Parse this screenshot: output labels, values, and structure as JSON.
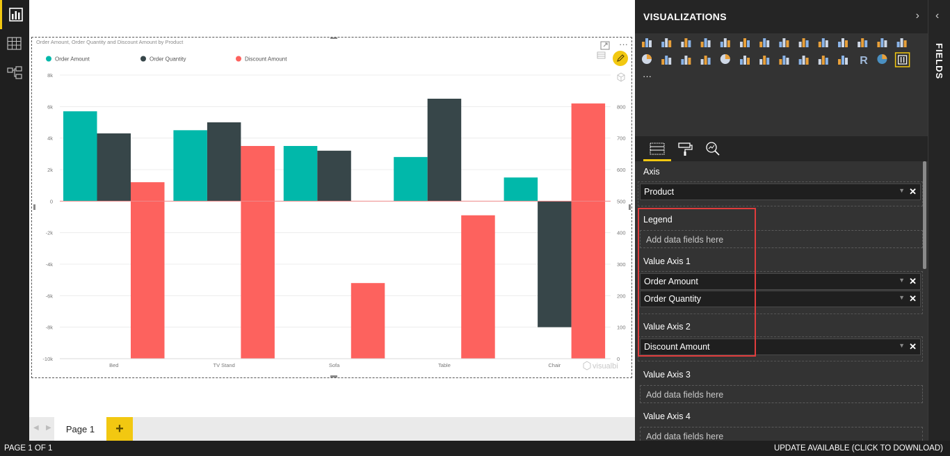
{
  "status_bar": {
    "page_indicator": "PAGE 1 OF 1",
    "update_notice": "UPDATE AVAILABLE (CLICK TO DOWNLOAD)"
  },
  "pages": {
    "tabs": [
      {
        "label": "Page 1"
      }
    ],
    "add_label": "+"
  },
  "visualizations_pane": {
    "title": "VISUALIZATIONS",
    "collapse_glyph": "›",
    "more_visuals_glyph": "···",
    "pane_tabs": [
      "fields-tab-icon",
      "format-paint-roller-icon",
      "analytics-magnifier-icon"
    ],
    "wells": {
      "axis": {
        "label": "Axis",
        "fields": [
          "Product"
        ]
      },
      "legend": {
        "label": "Legend",
        "placeholder": "Add data fields here"
      },
      "value_axis_1": {
        "label": "Value Axis 1",
        "fields": [
          "Order Amount",
          "Order Quantity"
        ]
      },
      "value_axis_2": {
        "label": "Value Axis 2",
        "fields": [
          "Discount Amount"
        ]
      },
      "value_axis_3": {
        "label": "Value Axis 3",
        "placeholder": "Add data fields here"
      },
      "value_axis_4": {
        "label": "Value Axis 4",
        "placeholder": "Add data fields here"
      }
    }
  },
  "fields_pane": {
    "label": "FIELDS",
    "collapse_glyph": "‹"
  },
  "visual": {
    "focus_mode_icon": "expand-icon",
    "more_options": "···",
    "watermark": "visualbi"
  },
  "chart_data": {
    "type": "bar",
    "title": "Order Amount, Order Quantity and Discount Amount by Product",
    "categories": [
      "Bed",
      "TV Stand",
      "Sofa",
      "Table",
      "Chair"
    ],
    "series": [
      {
        "name": "Order Amount",
        "axis": "left",
        "color": "#01b8aa",
        "values": [
          5700,
          4500,
          3500,
          2800,
          1500
        ]
      },
      {
        "name": "Order Quantity",
        "axis": "left",
        "color": "#374649",
        "values": [
          4300,
          5000,
          3200,
          6500,
          -8000
        ]
      },
      {
        "name": "Discount Amount",
        "axis": "right",
        "color": "#fd625e",
        "values": [
          560,
          675,
          240,
          455,
          810
        ]
      }
    ],
    "y_left": {
      "min": -10000,
      "max": 8000,
      "ticks": [
        8000,
        6000,
        4000,
        2000,
        0,
        -2000,
        -4000,
        -6000,
        -8000,
        -10000
      ],
      "tick_labels": [
        "8k",
        "6k",
        "4k",
        "2k",
        "0",
        "-2k",
        "-4k",
        "-6k",
        "-8k",
        "-10k"
      ]
    },
    "y_right": {
      "min": 0,
      "max": 900,
      "ticks": [
        800,
        700,
        600,
        500,
        400,
        300,
        200,
        100,
        0
      ],
      "tick_labels": [
        "800",
        "700",
        "600",
        "500",
        "400",
        "300",
        "200",
        "100",
        "0"
      ]
    },
    "legend_position": "top-left",
    "grid": true
  }
}
